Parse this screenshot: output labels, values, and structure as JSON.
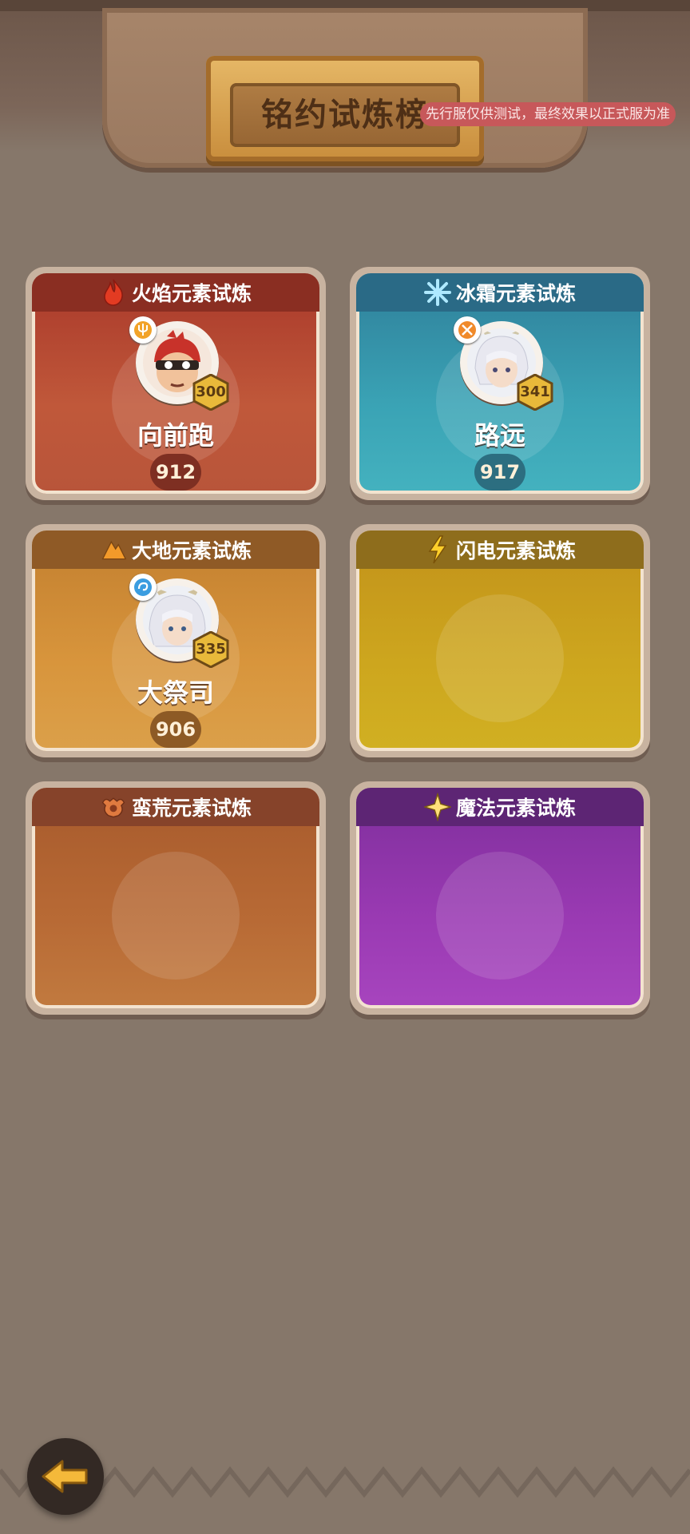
{
  "header": {
    "title": "铭约试炼榜",
    "notice": "先行服仅供测试，最终效果以正式服为准"
  },
  "colors": {
    "background": "#86776a",
    "fire": "#b34a33",
    "frost": "#3fa0b3",
    "earth": "#d5913b",
    "thunder": "#c7a41c",
    "wild": "#b8642f",
    "magic": "#9a3ab3"
  },
  "trials": [
    {
      "title": "火焰元素试炼",
      "icon": "flame-icon",
      "hero": {
        "name": "向前跑",
        "level": "300",
        "score": "912",
        "role_icon": "trident-icon"
      }
    },
    {
      "title": "冰霜元素试炼",
      "icon": "snowflake-icon",
      "hero": {
        "name": "路远",
        "level": "341",
        "score": "917",
        "role_icon": "crossed-swords-icon"
      }
    },
    {
      "title": "大地元素试炼",
      "icon": "mountain-icon",
      "hero": {
        "name": "大祭司",
        "level": "335",
        "score": "906",
        "role_icon": "swirl-icon"
      }
    },
    {
      "title": "闪电元素试炼",
      "icon": "lightning-icon"
    },
    {
      "title": "蛮荒元素试炼",
      "icon": "beast-icon"
    },
    {
      "title": "魔法元素试炼",
      "icon": "star-icon"
    }
  ],
  "back_button_icon": "back-arrow-icon"
}
